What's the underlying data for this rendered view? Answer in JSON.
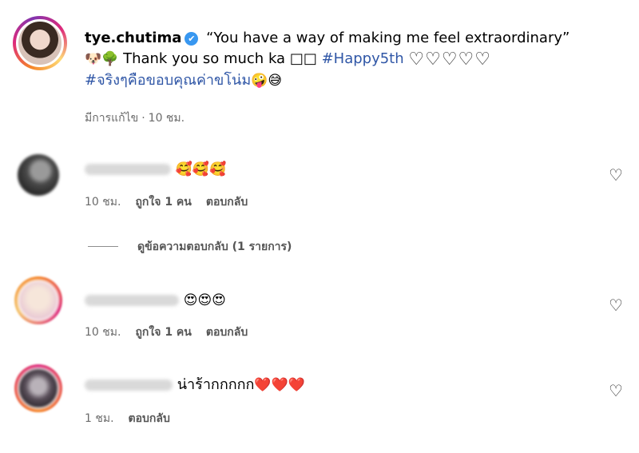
{
  "post": {
    "username": "tye.chutima",
    "verified_badge": "✔",
    "caption_quote": "“You have a way of making me feel extraordinary”",
    "caption_emojis_start": "🐶🌳",
    "caption_text": "Thank you so much ka",
    "caption_boxes": "□□",
    "hashtag_1": "#Happy5th",
    "caption_hearts": "♡♡♡♡♡",
    "hashtag_2": "#จริงๆคือขอบคุณค่าขโน่ม",
    "caption_emojis_end": "🤪😅",
    "edited_label": "มีการแก้ไข",
    "separator": "·",
    "time": "10 ชม."
  },
  "comments": [
    {
      "text": "🥰🥰🥰",
      "time": "10 ชม.",
      "likes": "ถูกใจ 1 คน",
      "reply": "ตอบกลับ",
      "view_replies": "ดูข้อความตอบกลับ (1 รายการ)"
    },
    {
      "text": "😍😍😍",
      "time": "10 ชม.",
      "likes": "ถูกใจ 1 คน",
      "reply": "ตอบกลับ"
    },
    {
      "text": "น่าร้ากกกกก",
      "hearts": "❤️❤️❤️",
      "time": "1 ชม.",
      "reply": "ตอบกลับ"
    }
  ],
  "icons": {
    "like": "♡",
    "verified": "verified-icon"
  },
  "colors": {
    "hashtag": "#2f56a6",
    "meta": "#6b6b6b",
    "verified": "#3897f0"
  }
}
